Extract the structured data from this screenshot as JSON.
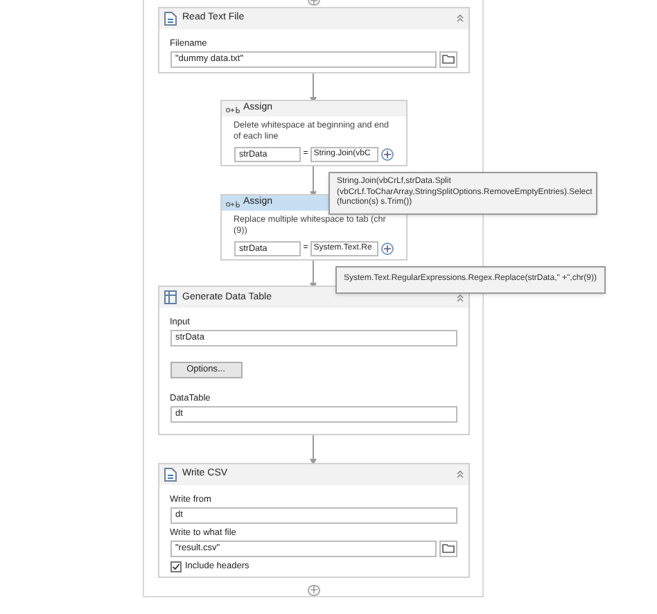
{
  "activities": [
    {
      "kind": "file_card",
      "title": "Read Text File",
      "rows": [
        {
          "kind": "field",
          "label": "Filename",
          "value": "\"dummy data.txt\"",
          "browse": true
        }
      ]
    },
    {
      "kind": "assign",
      "title": "Assign",
      "selected": false,
      "description": "Delete whitespace at beginning and end of each line",
      "to": "strData",
      "operator": "=",
      "value": "String.Join(vbC",
      "tooltip": "String.Join(vbCrLf,strData.Split (vbCrLf.ToCharArray,StringSplitOptions.RemoveEmptyEntries).Select (function(s) s.Trim())"
    },
    {
      "kind": "assign",
      "title": "Assign",
      "selected": true,
      "description": "Replace multiple whitespace to tab (chr (9))",
      "to": "strData",
      "operator": "=",
      "value": "System.Text.Re",
      "tooltip": "System.Text.RegularExpressions.Regex.Replace(strData,\" +\",chr(9))"
    },
    {
      "kind": "table_card",
      "title": "Generate Data Table",
      "rows": [
        {
          "kind": "field",
          "label": "Input",
          "value": "strData",
          "browse": false
        },
        {
          "kind": "button",
          "label": "Options..."
        },
        {
          "kind": "field",
          "label": "DataTable",
          "value": "dt",
          "browse": false
        }
      ]
    },
    {
      "kind": "file_card",
      "title": "Write CSV",
      "rows": [
        {
          "kind": "field",
          "label": "Write from",
          "value": "dt",
          "browse": false
        },
        {
          "kind": "field",
          "label": "Write to what file",
          "value": "\"result.csv\"",
          "browse": true
        },
        {
          "kind": "checkbox",
          "label": "Include headers",
          "checked": true
        }
      ]
    }
  ]
}
